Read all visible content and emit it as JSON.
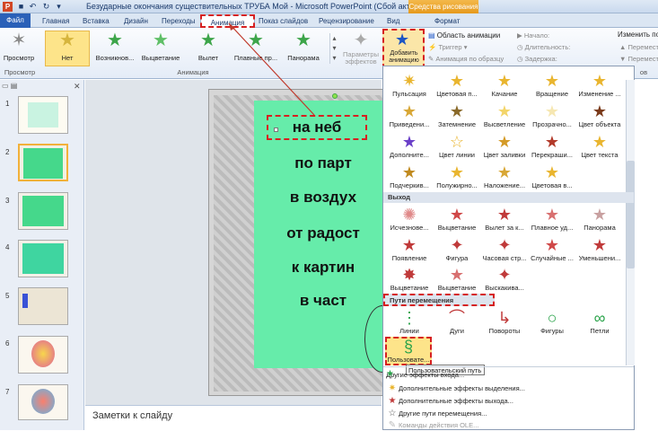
{
  "window": {
    "title": "Безударные окончания существительных ТРУБА  Мой  -  Microsoft PowerPoint (Сбой активации про...",
    "contextual_tab": "Средства рисования"
  },
  "tabs": [
    "Файл",
    "Главная",
    "Вставка",
    "Дизайн",
    "Переходы",
    "Анимация",
    "Показ слайдов",
    "Рецензирование",
    "Вид",
    "Формат"
  ],
  "ribbon": {
    "preview_label": "Просмотр",
    "preview_group": "Просмотр",
    "effects": [
      "Нет",
      "Возникнов...",
      "Выцветание",
      "Вылет",
      "Плавные пр...",
      "Панорама"
    ],
    "animation_group": "Анимация",
    "effect_params": "Параметры эффектов",
    "add_animation": "Добавить анимацию",
    "anim_area": "Область анимации",
    "trigger": "Триггер",
    "anim_painter": "Анимация по образцу",
    "start_label": "Начало:",
    "duration_label": "Длительность:",
    "delay_label": "Задержка:",
    "reorder": "Изменить по",
    "move_earlier": "Перемест",
    "move_later": "Перемест",
    "extras_label": "ов"
  },
  "slides": [
    {
      "num": "1"
    },
    {
      "num": "2"
    },
    {
      "num": "3"
    },
    {
      "num": "4"
    },
    {
      "num": "5"
    },
    {
      "num": "6"
    },
    {
      "num": "7"
    }
  ],
  "slide_words": [
    "на неб",
    "по парт",
    "в воздух",
    "от радост",
    "к картин",
    "в част"
  ],
  "notes_placeholder": "Заметки к слайду",
  "gallery": {
    "entrance_rows": [
      [
        "Пульсация",
        "Цветовая п...",
        "Качание",
        "Вращение",
        "Изменение ..."
      ],
      [
        "Приведени...",
        "Затемнение",
        "Высветление",
        "Прозрачно...",
        "Цвет объекта"
      ],
      [
        "Дополните...",
        "Цвет линии",
        "Цвет заливки",
        "Перекраши...",
        "Цвет текста"
      ],
      [
        "Подчеркив...",
        "Полужирно...",
        "Наложение...",
        "Цветовая в..."
      ]
    ],
    "exit_header": "Выход",
    "exit_rows": [
      [
        "Исчезнове...",
        "Выцветание",
        "Вылет за к...",
        "Плавное уд...",
        "Панорама"
      ],
      [
        "Появление",
        "Фигура",
        "Часовая стр...",
        "Случайные ...",
        "Уменьшени..."
      ],
      [
        "Выцветание",
        "Выцветание",
        "Выскакива..."
      ]
    ],
    "paths_header": "Пути перемещения",
    "paths": [
      "Линии",
      "Дуги",
      "Повороты",
      "Фигуры",
      "Петли"
    ],
    "custom_path": "Пользовате...",
    "tooltip": "Пользовательский путь",
    "menu_items": [
      "Другие эффекты входа...",
      "Дополнительные эффекты выделения...",
      "Дополнительные эффекты выхода...",
      "Другие пути перемещения...",
      "Команды действия OLE..."
    ]
  },
  "colors": {
    "accent": "#2a60b8",
    "highlight": "#d62020",
    "slide_green": "#66ecaa"
  }
}
